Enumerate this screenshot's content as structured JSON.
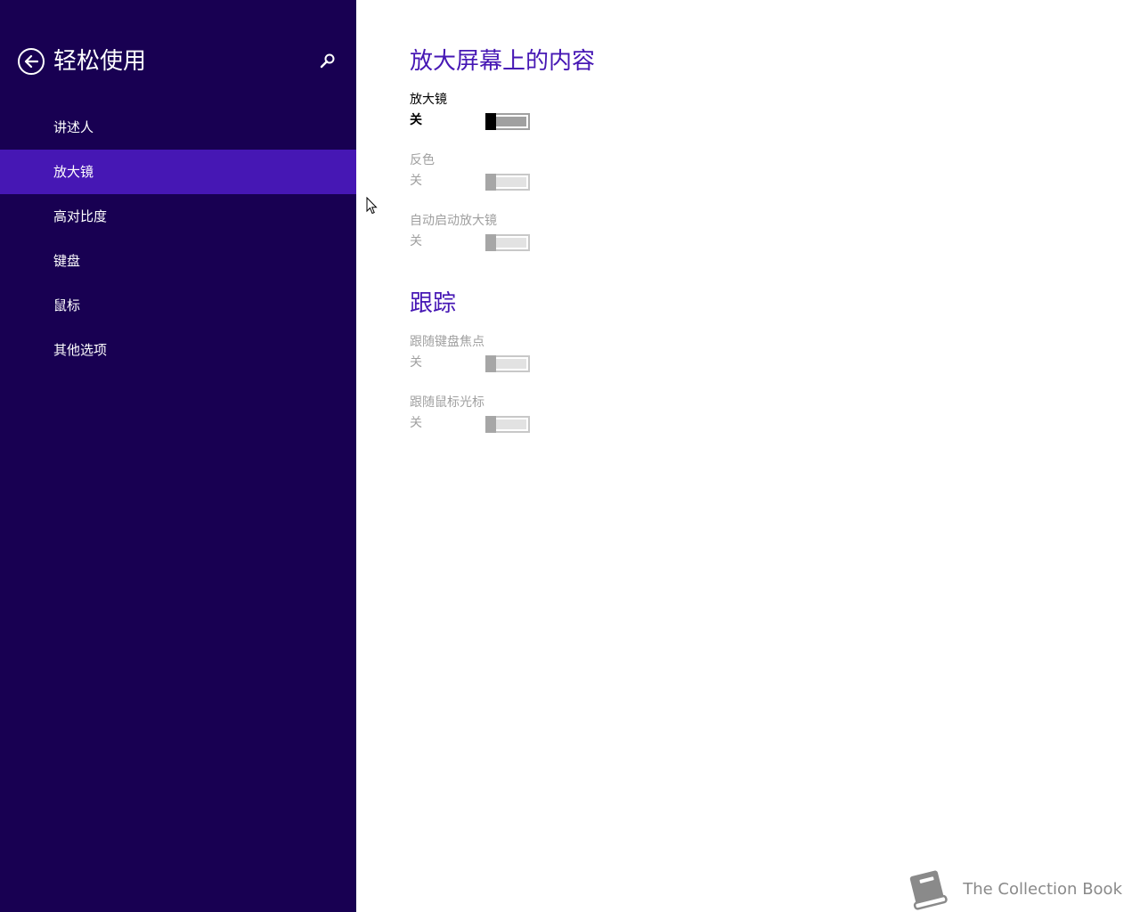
{
  "sidebar": {
    "title": "轻松使用",
    "items": [
      {
        "label": "讲述人",
        "active": false
      },
      {
        "label": "放大镜",
        "active": true
      },
      {
        "label": "高对比度",
        "active": false
      },
      {
        "label": "键盘",
        "active": false
      },
      {
        "label": "鼠标",
        "active": false
      },
      {
        "label": "其他选项",
        "active": false
      }
    ]
  },
  "main": {
    "zoom_section": {
      "title": "放大屏幕上的内容",
      "settings": [
        {
          "label": "放大镜",
          "state": "关",
          "enabled": true
        },
        {
          "label": "反色",
          "state": "关",
          "enabled": false
        },
        {
          "label": "自动启动放大镜",
          "state": "关",
          "enabled": false
        }
      ]
    },
    "tracking_section": {
      "title": "跟踪",
      "settings": [
        {
          "label": "跟随键盘焦点",
          "state": "关",
          "enabled": false
        },
        {
          "label": "跟随鼠标光标",
          "state": "关",
          "enabled": false
        }
      ]
    }
  },
  "watermark": {
    "text": "The Collection Book"
  },
  "colors": {
    "sidebar_bg": "#180052",
    "active_item_bg": "#4617b4",
    "accent": "#4617b4",
    "disabled_text": "#a0a0a0"
  }
}
